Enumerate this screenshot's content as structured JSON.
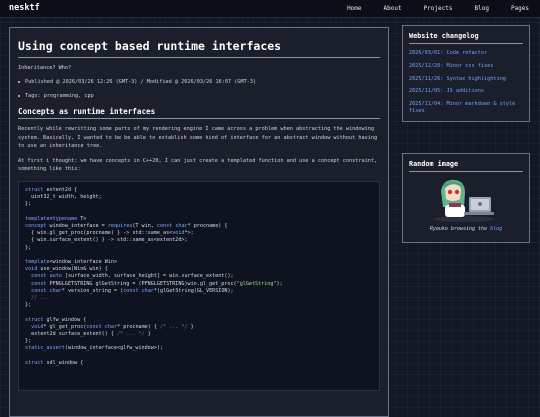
{
  "nav": {
    "brand": "nesktf",
    "links": [
      "Home",
      "About",
      "Projects",
      "Blog",
      "Pages"
    ]
  },
  "post": {
    "title": "Using concept based runtime interfaces",
    "subtitle": "Inheritance? Who?",
    "meta_dates": "Published @ 2026/03/26 12:26 (GMT-3) / Modified @ 2026/03/26 16:07 (GMT-3)",
    "tags": "Tags: programming, cpp",
    "section_heading": "Concepts as runtime interfaces",
    "paragraph1": "Recently while rewritting some parts of my rendering engine I came across a problem when abstracting the windowing system. Basically, I wanted to be be able to establish some kind of interface for an abstract window without having to use an inheritance tree.",
    "paragraph2": "At first i thought: we have concepts in C++20, I can just create a templated function and use a concept constraint, something like this:",
    "code_lines": [
      "struct extent2d {",
      "  uint32_t width, height;",
      "};",
      "",
      "template<typename T>",
      "concept window_interface = requires(T win, const char* procname) {",
      "  { win.gl_get_proc(procname) } -> std::same_as<void*>;",
      "  { win.surface_extent() } -> std::same_as<extent2d>;",
      "};",
      "",
      "template<window_interface Win>",
      "void use_window(Win& win) {",
      "  const auto [surface_width, surface_height] = win.surface_extent();",
      "  const PFNGLGETSTRING glGetString = (PFNGLGETSTRING)win.gl_get_proc(\"glGetString\");",
      "  const char* version_string = (const char*)glGetString(GL_VERSION);",
      "  // ...",
      "};",
      "",
      "struct glfw_window {",
      "  void* gl_get_proc(const char* procname) { /* ... */ }",
      "  extent2d surface_extent() { /* ... */ }",
      "};",
      "static_assert(window_interface<glfw_window>);",
      "",
      "struct sdl_window {"
    ]
  },
  "changelog": {
    "title": "Website changelog",
    "items": [
      "2026/03/01: Code refactor",
      "2025/12/20: Minor css fixes",
      "2025/11/26: Syntax highlighting",
      "2025/11/05: JS additions",
      "2025/11/04: Minor markdown & style fixes"
    ]
  },
  "random_image": {
    "title": "Random image",
    "caption_text": "Ryouko browsing the",
    "caption_link": "blog"
  },
  "colors": {
    "background": "#141824",
    "panel": "#1b1f2c",
    "link": "#6fa3ff",
    "keyword": "#7ea6ff",
    "string": "#9ee08a"
  }
}
